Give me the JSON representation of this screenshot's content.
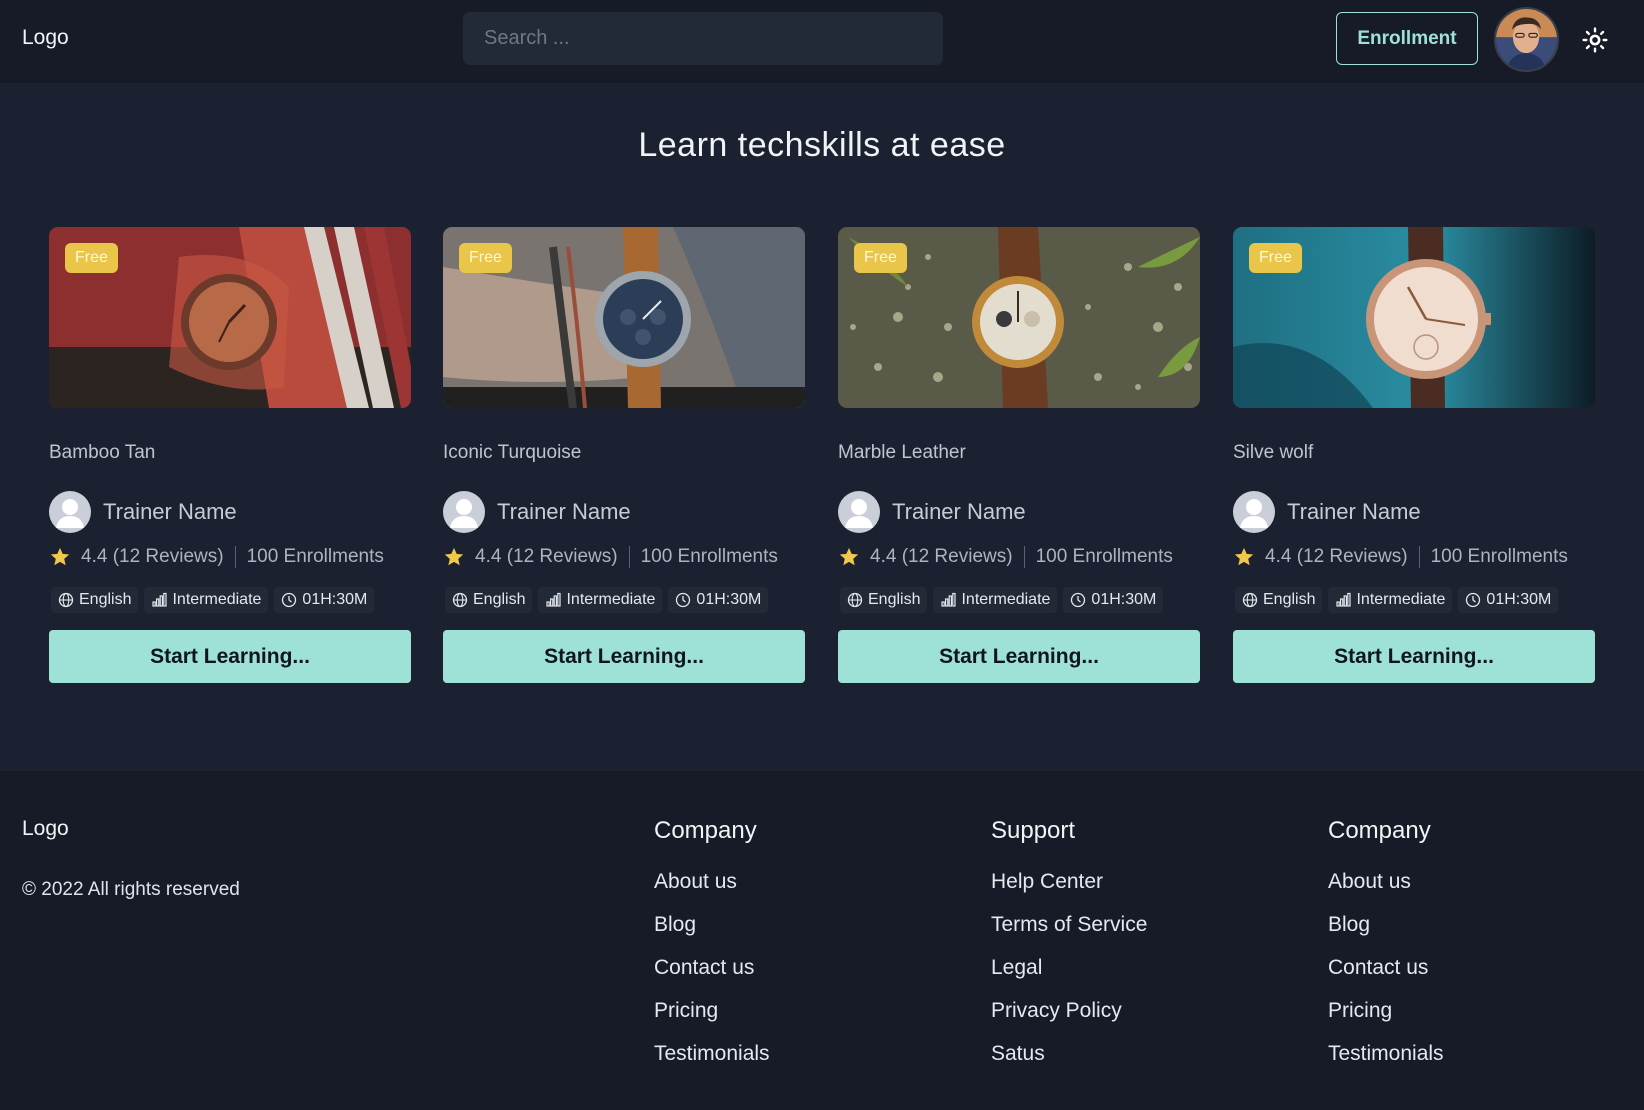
{
  "header": {
    "logo": "Logo",
    "search_placeholder": "Search ...",
    "enroll_label": "Enrollment",
    "avatar_icon": "user-avatar",
    "theme_icon": "sun-icon"
  },
  "hero": {
    "title": "Learn techskills at ease"
  },
  "colors": {
    "accent": "#9ee1d7",
    "badge": "#e9c64a",
    "star": "#f0c84b",
    "bg": "#1b2130",
    "bar": "#161b27"
  },
  "cards": [
    {
      "badge": "Free",
      "title": "Bamboo Tan",
      "trainer": "Trainer Name",
      "rating": "4.4 (12 Reviews)",
      "enrollments": "100 Enrollments",
      "language": "English",
      "level": "Intermediate",
      "duration": "01H:30M",
      "cta": "Start Learning..."
    },
    {
      "badge": "Free",
      "title": "Iconic Turquoise",
      "trainer": "Trainer Name",
      "rating": "4.4 (12 Reviews)",
      "enrollments": "100 Enrollments",
      "language": "English",
      "level": "Intermediate",
      "duration": "01H:30M",
      "cta": "Start Learning..."
    },
    {
      "badge": "Free",
      "title": "Marble Leather",
      "trainer": "Trainer Name",
      "rating": "4.4 (12 Reviews)",
      "enrollments": "100 Enrollments",
      "language": "English",
      "level": "Intermediate",
      "duration": "01H:30M",
      "cta": "Start Learning..."
    },
    {
      "badge": "Free",
      "title": "Silve wolf",
      "trainer": "Trainer Name",
      "rating": "4.4 (12 Reviews)",
      "enrollments": "100 Enrollments",
      "language": "English",
      "level": "Intermediate",
      "duration": "01H:30M",
      "cta": "Start Learning..."
    }
  ],
  "footer": {
    "logo": "Logo",
    "copyright": "© 2022 All rights reserved",
    "columns": [
      {
        "heading": "Company",
        "links": [
          "About us",
          "Blog",
          "Contact us",
          "Pricing",
          "Testimonials"
        ]
      },
      {
        "heading": "Support",
        "links": [
          "Help Center",
          "Terms of Service",
          "Legal",
          "Privacy Policy",
          "Satus"
        ]
      },
      {
        "heading": "Company",
        "links": [
          "About us",
          "Blog",
          "Contact us",
          "Pricing",
          "Testimonials"
        ]
      }
    ]
  }
}
